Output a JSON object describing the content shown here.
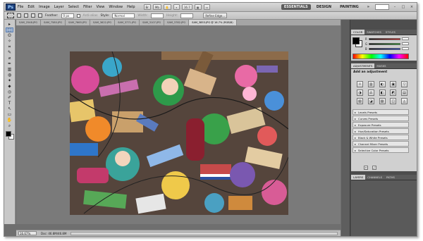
{
  "app": {
    "logo": "Ps",
    "menu": [
      "File",
      "Edit",
      "Image",
      "Layer",
      "Select",
      "Filter",
      "View",
      "Window",
      "Help"
    ],
    "bar_buttons": [
      "Br",
      "Mb"
    ],
    "zoom": "16.7",
    "workspaces": [
      "ESSENTIALS",
      "DESIGN",
      "PAINTING"
    ],
    "more": "»",
    "window_controls": [
      "–",
      "□",
      "×"
    ]
  },
  "options": {
    "feather_label": "Feather:",
    "feather_value": "0 px",
    "antialias_label": "Anti-alias",
    "style_label": "Style:",
    "style_value": "Normal",
    "width_label": "Width:",
    "height_label": "Height:",
    "refine_edge": "Refine Edge..."
  },
  "doc_tabs": [
    "SAM_2548.JPG",
    "SAM_7580.JPG",
    "SAM_7665.JPG",
    "SAM_3622.JPG",
    "SAM_3771.JPG",
    "SAM_3107.JPG",
    "SAM_3782.JPG",
    "SAM_3853.JPG @ 16.7% (RGB/8)"
  ],
  "status": {
    "zoom": "16.67%",
    "doc": "Doc: 46.8M/46.8M"
  },
  "tools": [
    "▸",
    "⬚",
    "ʘ",
    "✧",
    "⌗",
    "✎",
    "⌀",
    "✒",
    "▥",
    "◍",
    "✦",
    "⬥",
    "◎",
    "✐",
    "T",
    "↖",
    "▭",
    "✋",
    "⌕"
  ],
  "color_panel": {
    "tabs": [
      "COLOR",
      "SWATCHES",
      "STYLES"
    ],
    "channels": [
      "R",
      "G",
      "B"
    ],
    "colors": {
      "r": "#e02020",
      "g": "#20a020",
      "b": "#2040d0"
    }
  },
  "adjustments": {
    "tabs": [
      "ADJUSTMENTS",
      "MASKS"
    ],
    "title": "Add an adjustment",
    "row1": [
      "☼",
      "▥",
      "◐",
      "▣",
      "▽"
    ],
    "row2": [
      "◑",
      "⚖",
      "◧",
      "◩",
      "▤"
    ],
    "row3": [
      "▧",
      "◪",
      "▨",
      "◫",
      "◬"
    ],
    "presets": [
      "Levels Presets",
      "Curves Presets",
      "Exposure Presets",
      "Hue/Saturation Presets",
      "Black & White Presets",
      "Channel Mixer Presets",
      "Selective Color Presets"
    ]
  },
  "layers_panel": {
    "tabs": [
      "LAYERS",
      "CHANNELS",
      "PATHS"
    ]
  }
}
